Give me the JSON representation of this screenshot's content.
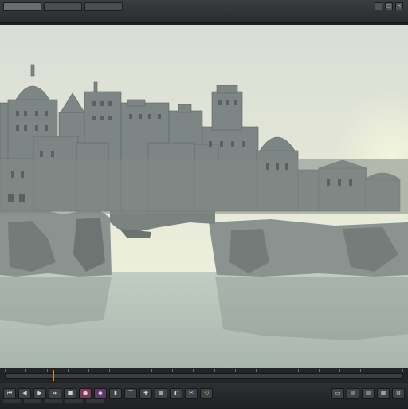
{
  "window": {
    "title": "",
    "tabs": [
      {
        "label": "",
        "active": true
      },
      {
        "label": "",
        "active": false
      },
      {
        "label": "",
        "active": false
      }
    ],
    "controls": [
      "–",
      "□",
      "×"
    ]
  },
  "menu": [],
  "viewport": {
    "content": "island-city-render",
    "sky_color": "#e6ead8",
    "water_color": "#b8c4bb",
    "city_color": "#7d8684"
  },
  "timeline": {
    "playhead_fraction": 0.12
  },
  "toolbar": {
    "left_buttons": [
      "⏮",
      "◀",
      "▶",
      "⏭",
      "■",
      "●",
      "◆",
      "▮",
      "⌒",
      "✚",
      "▦",
      "◐",
      "✂",
      "⟲"
    ],
    "right_buttons": [
      "▭",
      "▤",
      "▥",
      "▦",
      "⚙"
    ]
  }
}
